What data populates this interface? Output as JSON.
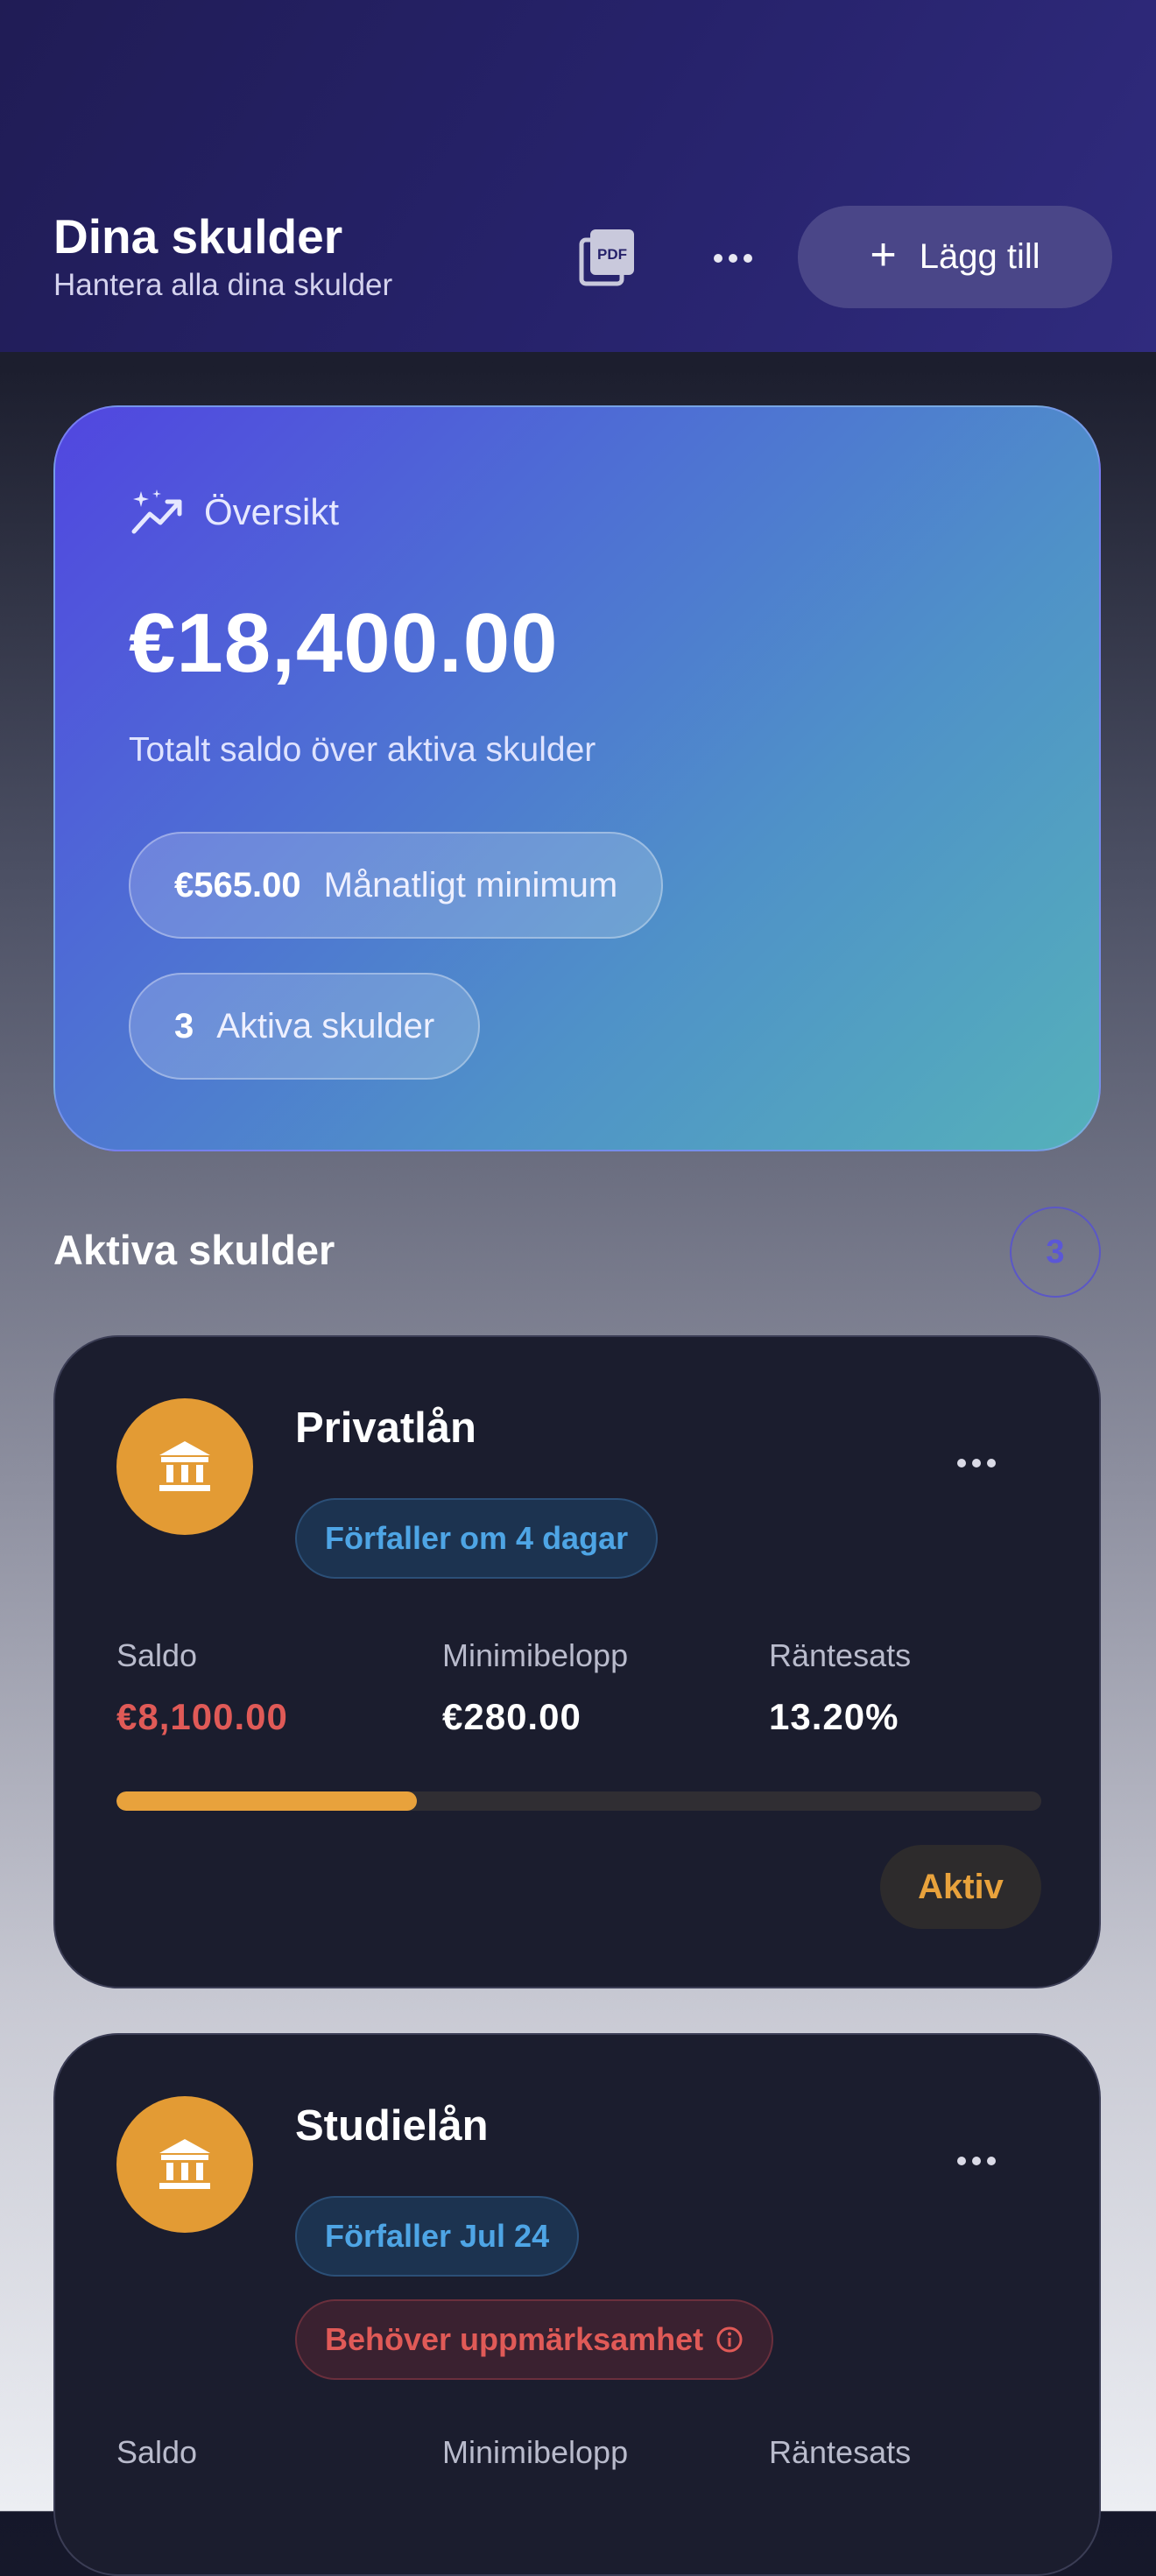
{
  "header": {
    "title": "Dina skulder",
    "subtitle": "Hantera alla dina skulder",
    "add_label": "Lägg till",
    "pdf_icon": "pdf-icon",
    "more_icon": "more-horizontal-icon"
  },
  "overview": {
    "label": "Översikt",
    "total": "€18,400.00",
    "description": "Totalt saldo över aktiva skulder",
    "monthly_min_value": "€565.00",
    "monthly_min_label": "Månatligt minimum",
    "active_count": "3",
    "active_label": "Aktiva skulder"
  },
  "section": {
    "title": "Aktiva skulder",
    "count": "3"
  },
  "debts": [
    {
      "name": "Privatlån",
      "due": "Förfaller om 4 dagar",
      "saldo_label": "Saldo",
      "saldo": "€8,100.00",
      "min_label": "Minimibelopp",
      "min": "€280.00",
      "rate_label": "Räntesats",
      "rate": "13.20%",
      "progress": 0.325,
      "status": "Aktiv"
    },
    {
      "name": "Studielån",
      "due": "Förfaller Jul 24",
      "warning": "Behöver uppmärksamhet",
      "saldo_label": "Saldo",
      "min_label": "Minimibelopp",
      "rate_label": "Räntesats"
    }
  ],
  "colors": {
    "accent_orange": "#e8a23c",
    "danger_red": "#e05a57",
    "info_blue": "#4ea5e5",
    "card_bg": "#1b1d2e"
  }
}
